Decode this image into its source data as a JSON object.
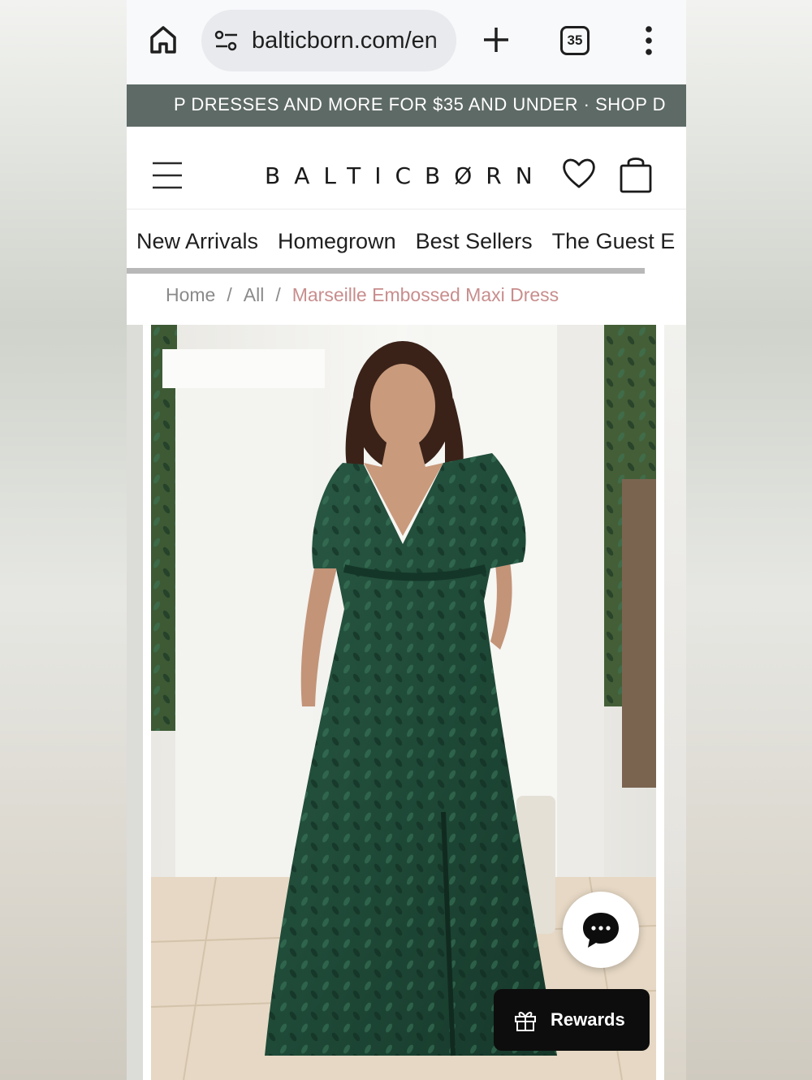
{
  "browser": {
    "url": "balticborn.com/en",
    "tab_count": "35"
  },
  "promo": {
    "text": "P DRESSES AND MORE FOR $35 AND UNDER · SHOP D"
  },
  "header": {
    "logo": "BALTICBØRN"
  },
  "nav": {
    "items": [
      "New Arrivals",
      "Homegrown",
      "Best Sellers",
      "The Guest E"
    ]
  },
  "breadcrumb": {
    "home": "Home",
    "all": "All",
    "current": "Marseille Embossed Maxi Dress",
    "separator": "/"
  },
  "rewards": {
    "label": "Rewards"
  },
  "colors": {
    "promo_bg": "#5e6a66",
    "breadcrumb_current": "#c88d8d",
    "dress_green": "#1f4a38",
    "rewards_bg": "#0d0d0d"
  },
  "icons": [
    "home-icon",
    "site-settings-icon",
    "plus-icon",
    "tab-switcher-icon",
    "more-vert-icon",
    "hamburger-menu-icon",
    "heart-icon",
    "shopping-bag-icon",
    "chat-bubble-icon",
    "gift-icon"
  ]
}
